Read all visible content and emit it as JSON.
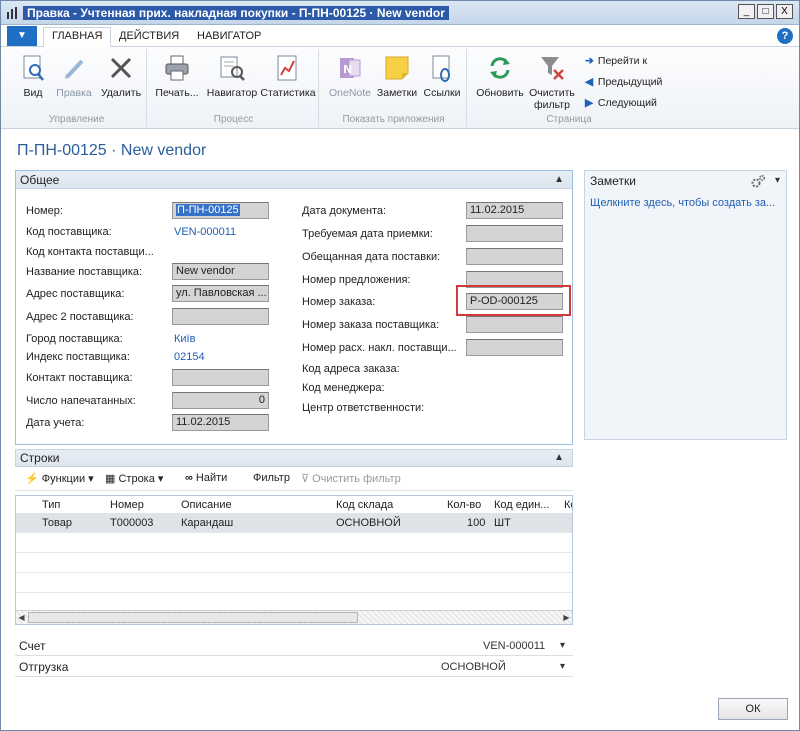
{
  "window": {
    "title": "Правка - Учтенная прих. накладная покупки - П-ПН-00125 · New vendor",
    "min": "_",
    "max": "□",
    "close": "X"
  },
  "tabs": [
    {
      "label": "ГЛАВНАЯ"
    },
    {
      "label": "ДЕЙСТВИЯ"
    },
    {
      "label": "НАВИГАТОР"
    }
  ],
  "help": "?",
  "ribbon": {
    "groups": [
      {
        "label": "Управление"
      },
      {
        "label": "Процесс"
      },
      {
        "label": "Показать приложения"
      },
      {
        "label": "Страница"
      }
    ],
    "buttons": {
      "view": "Вид",
      "edit": "Правка",
      "delete": "Удалить",
      "print": "Печать...",
      "navigator": "Навигатор",
      "statistics": "Статистика",
      "onenote": "OneNote",
      "notes": "Заметки",
      "links": "Ссылки",
      "refresh": "Обновить",
      "clear_filter": "Очистить фильтр",
      "goto": "Перейти к",
      "prev": "Предыдущий",
      "next": "Следующий"
    }
  },
  "page_title": "П-ПН-00125 · New vendor",
  "general": {
    "header": "Общее",
    "fields": {
      "number_label": "Номер:",
      "number_value": "П-ПН-00125",
      "vendor_code_label": "Код поставщика:",
      "vendor_code_value": "VEN-000011",
      "vendor_contact_code_label": "Код контакта поставщи...",
      "vendor_name_label": "Название поставщика:",
      "vendor_name_value": "New vendor",
      "vendor_address_label": "Адрес поставщика:",
      "vendor_address_value": "ул. Павловская ...",
      "vendor_address2_label": "Адрес 2 поставщика:",
      "vendor_address2_value": "",
      "vendor_city_label": "Город поставщика:",
      "vendor_city_value": "Київ",
      "vendor_zip_label": "Индекс поставщика:",
      "vendor_zip_value": "02154",
      "vendor_contact_label": "Контакт поставщика:",
      "vendor_contact_value": "",
      "printed_label": "Число напечатанных:",
      "printed_value": "0",
      "posting_date_label": "Дата учета:",
      "posting_date_value": "11.02.2015",
      "doc_date_label": "Дата документа:",
      "doc_date_value": "11.02.2015",
      "req_receipt_label": "Требуемая дата приемки:",
      "req_receipt_value": "",
      "promised_label": "Обещанная дата поставки:",
      "promised_value": "",
      "quote_label": "Номер предложения:",
      "quote_value": "",
      "order_label": "Номер заказа:",
      "order_value": "P-OD-000125",
      "vendor_order_label": "Номер заказа поставщика:",
      "vendor_order_value": "",
      "vendor_invoice_label": "Номер расх. накл. поставщи...",
      "vendor_invoice_value": "",
      "order_addr_label": "Код адреса заказа:",
      "manager_label": "Код менеджера:",
      "resp_center_label": "Центр ответственности:"
    }
  },
  "notes": {
    "header": "Заметки",
    "link": "Щелкните здесь, чтобы создать за..."
  },
  "lines": {
    "header": "Строки",
    "toolbar": {
      "functions": "Функции",
      "line": "Строка",
      "find": "Найти",
      "filter": "Фильтр",
      "clear_filter": "Очистить фильтр"
    },
    "columns": [
      "Тип",
      "Номер",
      "Описание",
      "Код склада",
      "Кол-во",
      "Код един...",
      "Ко"
    ],
    "rows": [
      {
        "type": "Товар",
        "no": "T000003",
        "desc": "Карандаш",
        "location": "ОСНОВНОЙ",
        "qty": "100",
        "uom": "ШТ"
      }
    ]
  },
  "invoicing": {
    "label": "Счет",
    "summary": "VEN-000011"
  },
  "shipping": {
    "label": "Отгрузка",
    "summary": "ОСНОВНОЙ"
  },
  "ok": "ОК"
}
